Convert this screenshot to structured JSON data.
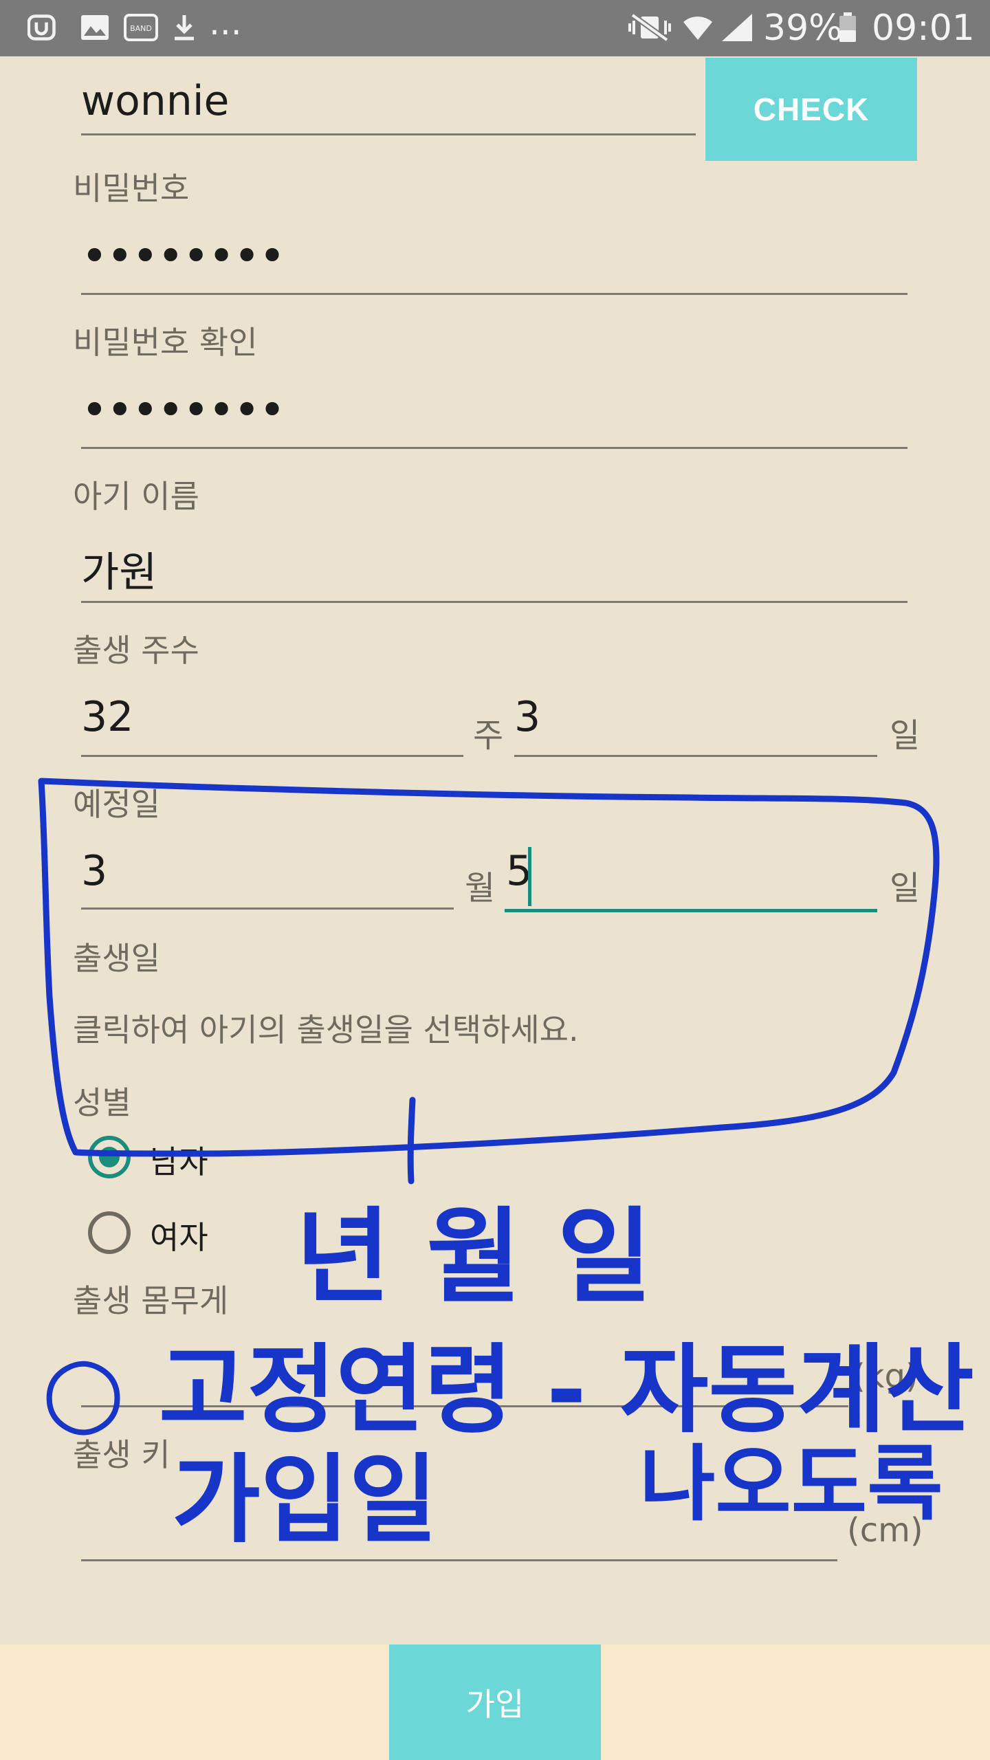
{
  "status_bar": {
    "battery": "39%",
    "time": "09:01",
    "overflow": "...",
    "icons": [
      "u-plus-icon",
      "gallery-icon",
      "band-app-icon",
      "download-icon",
      "mute-vibrate-icon",
      "wifi-icon",
      "signal-icon",
      "battery-icon"
    ],
    "band_label": "BAND"
  },
  "form": {
    "user_id_value": "wonnie",
    "check_label": "CHECK",
    "password_label": "비밀번호",
    "password_value": "••••••••",
    "password_confirm_label": "비밀번호 확인",
    "password_confirm_value": "••••••••",
    "baby_name_label": "아기 이름",
    "baby_name_value": "가원",
    "gestation_label": "출생 주수",
    "gestation_weeks": "32",
    "weeks_unit": "주",
    "gestation_days": "3",
    "days_unit": "일",
    "due_date_label": "예정일",
    "due_month": "3",
    "month_unit": "월",
    "due_day": "5",
    "day_unit": "일",
    "birth_date_label": "출생일",
    "birth_date_hint": "클릭하여 아기의 출생일을 선택하세요.",
    "gender_label": "성별",
    "gender_options": [
      {
        "label": "남자",
        "selected": true
      },
      {
        "label": "여자",
        "selected": false
      }
    ],
    "birth_weight_label": "출생 몸무게",
    "weight_unit": "(kg)",
    "birth_height_label": "출생 키",
    "height_unit": "(cm)"
  },
  "join_label": "가입",
  "annotation_note": {
    "line1": "년 월 일",
    "line2": "○ 고정연령 - 자동계산",
    "line3": "가입일",
    "line4": "나오도록"
  },
  "colors": {
    "background": "#ebe3d0",
    "status_bar": "#7a7a7a",
    "accent_teal": "#1a8d7e",
    "button_cyan": "#6bd7d6",
    "bottom_bar": "#f8e9ca",
    "annotation_blue": "#1736c9"
  }
}
